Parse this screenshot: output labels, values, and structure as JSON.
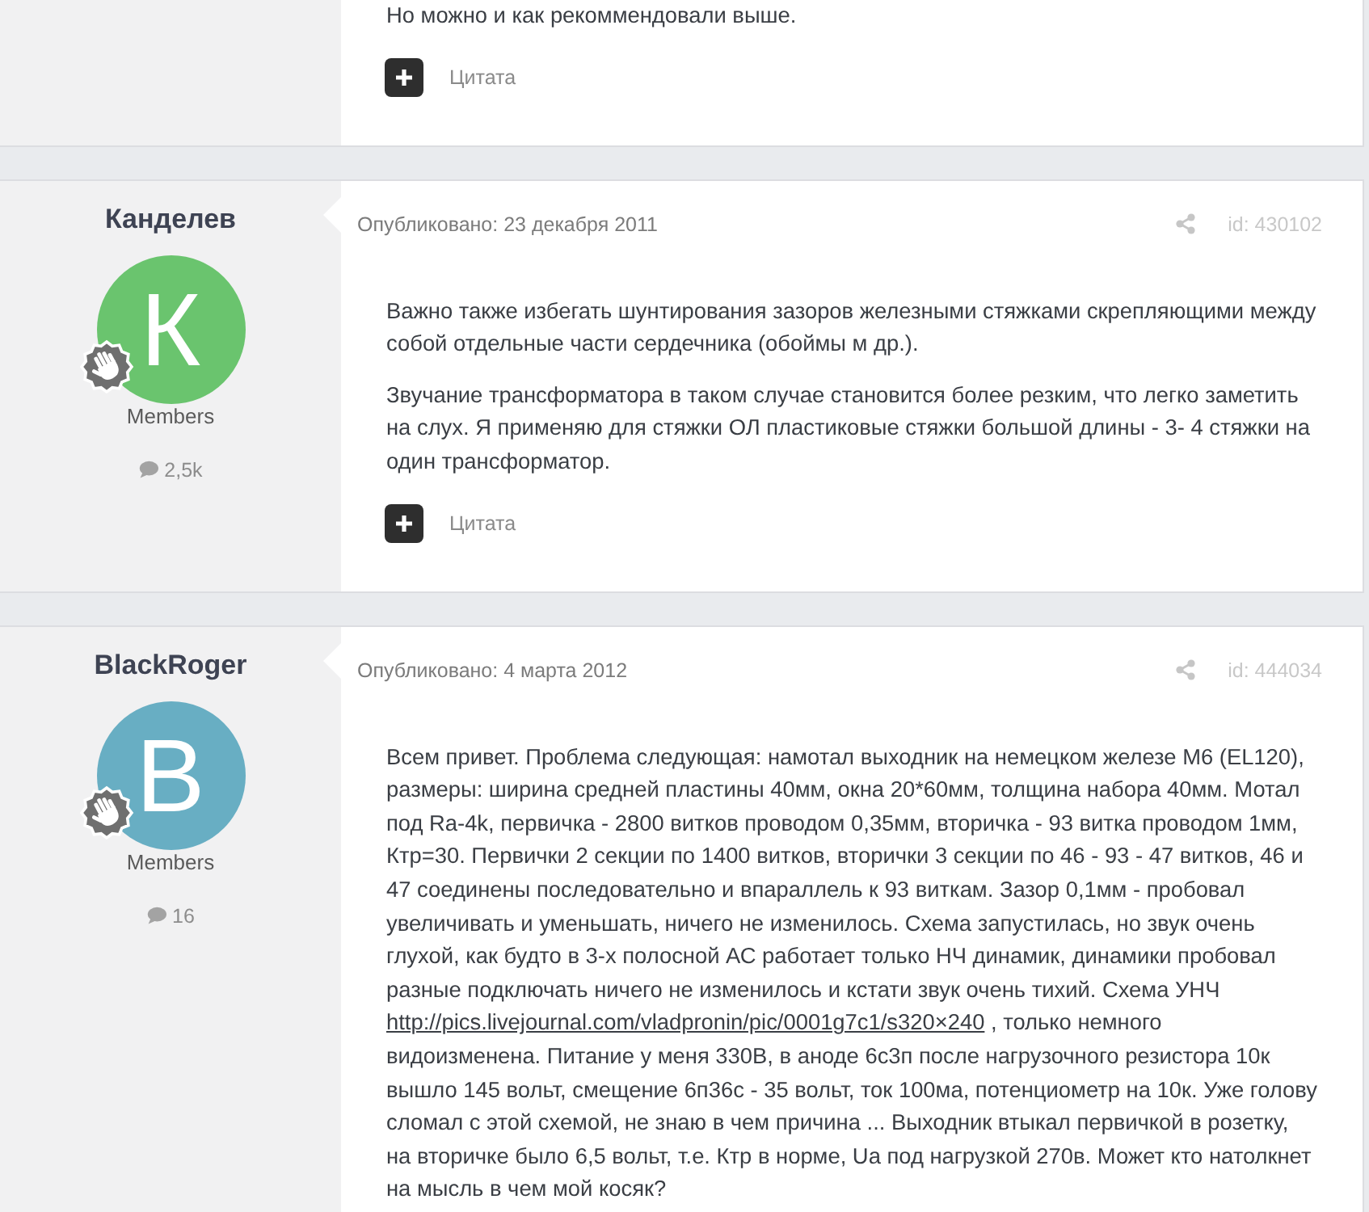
{
  "posts": [
    {
      "body": [
        [
          {
            "kind": "text",
            "text": "Но можно и как рекоммендовали выше."
          }
        ]
      ],
      "quote_label": "Цитата"
    },
    {
      "author": "Канделев",
      "avatar": {
        "letter": "К",
        "color": "#6ac46e"
      },
      "group": "Members",
      "post_count": "2,5k",
      "date": "Опубликовано: 23 декабря 2011",
      "post_id": "id: 430102",
      "body": [
        [
          {
            "kind": "text",
            "text": "Важно также избегать шунтирования зазоров железными стяжками скрепляющими между собой отдельные части сердечника (обоймы м др.)."
          }
        ],
        [
          {
            "kind": "text",
            "text": "Звучание трансформатора в таком случае становится более резким, что легко заметить на слух. Я применяю для стяжки ОЛ пластиковые стяжки большой длины - 3- 4 стяжки на один трансформатор."
          }
        ]
      ],
      "quote_label": "Цитата"
    },
    {
      "author": "BlackRoger",
      "avatar": {
        "letter": "B",
        "color": "#68aec3"
      },
      "group": "Members",
      "post_count": "16",
      "date": "Опубликовано: 4 марта 2012",
      "post_id": "id: 444034",
      "body": [
        [
          {
            "kind": "text",
            "text": "Всем привет. Проблема следующая: намотал выходник на немецком железе М6 (EL120), размеры: ширина средней пластины 40мм, окна 20*60мм, толщина набора 40мм. Мотал под Ra-4k, первичка - 2800 витков проводом 0,35мм, вторичка - 93 витка проводом 1мм, Ктр=30. Первички 2 секции по 1400 витков, вторички 3 секции по 46 - 93 - 47 витков, 46 и 47 соединены последовательно и впараллель к 93 виткам. Зазор 0,1мм - пробовал увеличивать и уменьшать, ничего не изменилось. Схема запустилась, но звук очень глухой, как будто в 3-х полосной АС работает только НЧ динамик, динамики пробовал разные подключать ничего не изменилось и кстати звук очень тихий. Схема УНЧ "
          },
          {
            "kind": "link",
            "text": "http://pics.livejournal.com/vladpronin/pic/0001g7c1/s320×240"
          },
          {
            "kind": "text",
            "text": " , только немного видоизменена. Питание у меня 330В, в аноде 6с3п после нагрузочного резистора 10к вышло 145 вольт, смещение 6п36с - 35 вольт, ток 100ма, потенциометр на 10к. Уже голову сломал с этой схемой, не знаю в чем причина ... Выходник втыкал первичкой в розетку, на вторичке было 6,5 вольт, т.е. Ктр в норме, Ua под нагрузкой 270в. Может кто натолкнет на мысль в чем мой косяк?"
          }
        ]
      ]
    }
  ]
}
